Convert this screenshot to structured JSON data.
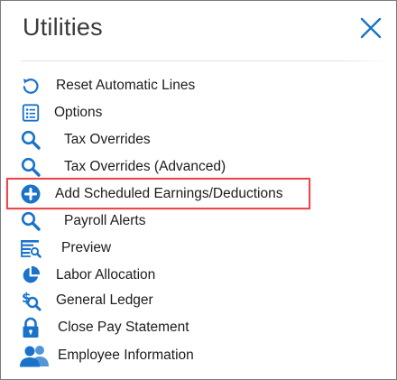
{
  "panel": {
    "title": "Utilities",
    "close_icon": "close-icon",
    "accent_color": "#1a73c9",
    "highlight_color": "#e8494d"
  },
  "menu": {
    "items": [
      {
        "label": "Reset Automatic Lines",
        "icon": "reset-icon"
      },
      {
        "label": "Options",
        "icon": "options-list-icon"
      },
      {
        "label": "Tax Overrides",
        "icon": "search-icon"
      },
      {
        "label": "Tax Overrides (Advanced)",
        "icon": "search-icon"
      },
      {
        "label": "Add Scheduled Earnings/Deductions",
        "icon": "add-circle-icon",
        "highlighted": true
      },
      {
        "label": "Payroll Alerts",
        "icon": "search-icon"
      },
      {
        "label": "Preview",
        "icon": "preview-icon"
      },
      {
        "label": "Labor Allocation",
        "icon": "pie-chart-icon"
      },
      {
        "label": "General Ledger",
        "icon": "ledger-search-icon"
      },
      {
        "label": "Close Pay Statement",
        "icon": "lock-icon"
      },
      {
        "label": "Employee Information",
        "icon": "people-icon"
      }
    ]
  }
}
